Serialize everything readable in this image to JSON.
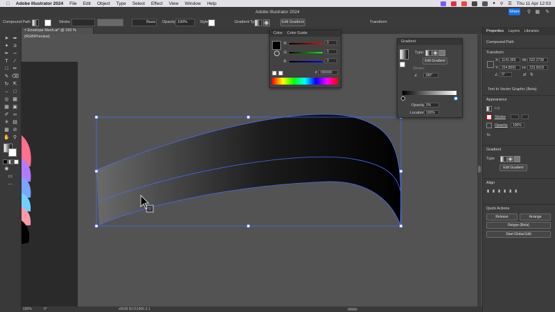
{
  "menubar": {
    "apple": "",
    "app_name": "Adobe Illustrator 2024",
    "items": [
      "File",
      "Edit",
      "Object",
      "Type",
      "Select",
      "Effect",
      "View",
      "Window",
      "Help"
    ],
    "datetime": "Thu 11 Apr  12:03"
  },
  "titlebar": {
    "title": "Adobe Illustrator 2024",
    "share_label": "Share"
  },
  "control_bar": {
    "object_type": "Compound Path",
    "stroke_label": "Stroke",
    "brush": "Basic",
    "opacity_label": "Opacity",
    "opacity_value": "100%",
    "style_label": "Style",
    "gradient_type_label": "Gradient Type",
    "edit_gradient": "Edit Gradient",
    "transform": "Transform"
  },
  "document_tab": "Envelope Mesh.ai* @ 150 % (RGB/Preview)",
  "color_panel": {
    "tabs": [
      "Color",
      "Color Guide"
    ],
    "channels": [
      {
        "label": "R",
        "value": "0"
      },
      {
        "label": "G",
        "value": "0"
      },
      {
        "label": "B",
        "value": "0"
      }
    ],
    "hex_symbol": "#",
    "hex_value": "000000"
  },
  "gradient_panel": {
    "title": "Gradient",
    "type_label": "Type:",
    "edit_gradient": "Edit Gradient",
    "stroke_label": "Stroke:",
    "angle_value": "180°",
    "opacity_label": "Opacity:",
    "opacity_value": "0%",
    "location_label": "Location:",
    "location_value": "100%"
  },
  "properties": {
    "tabs": [
      "Properties",
      "Layers",
      "Libraries"
    ],
    "selection": "Compound Path",
    "transform_title": "Transform",
    "x_label": "X:",
    "x_value": "1141.065",
    "y_label": "Y:",
    "y_value": "224.8591",
    "w_label": "W:",
    "w_value": "622.2738",
    "h_label": "H:",
    "h_value": "223.5018",
    "angle_value": "0°",
    "text_to_vector": "Text to Vector Graphic (Beta)",
    "appearance_title": "Appearance",
    "fill_label": "Fill",
    "stroke_label": "Stroke",
    "opacity_label": "Opacity",
    "opacity_value": "100%",
    "fx_label": "fx.",
    "gradient_title": "Gradient",
    "type_label": "Type",
    "edit_gradient": "Edit Gradient",
    "align_title": "Align",
    "quick_actions_title": "Quick Actions",
    "release_btn": "Release",
    "arrange_btn": "Arrange",
    "retype_btn": "Retype (Beta)",
    "global_edit_btn": "Start Global Edit"
  },
  "status_bar": {
    "zoom": "150%",
    "rotation": "0°",
    "profile": "sRGB IEC61966-2.1"
  },
  "colors": {
    "accent": "#1473e6",
    "panel": "#424242",
    "canvas": "#535353",
    "selection": "#4a6cff"
  }
}
